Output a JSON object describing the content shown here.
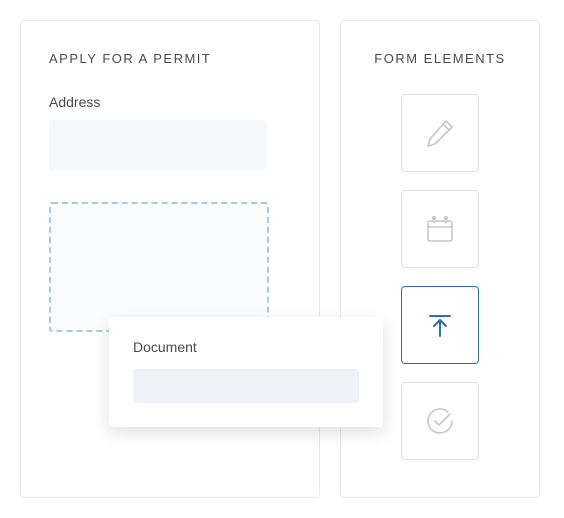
{
  "form": {
    "title": "APPLY FOR A PERMIT",
    "address_label": "Address"
  },
  "floating": {
    "label": "Document"
  },
  "palette": {
    "title": "FORM ELEMENTS",
    "items": [
      {
        "icon": "pencil",
        "active": false
      },
      {
        "icon": "calendar",
        "active": false
      },
      {
        "icon": "upload",
        "active": true
      },
      {
        "icon": "check-circle",
        "active": false
      }
    ]
  },
  "colors": {
    "accent": "#2f6fb0",
    "muted": "#c7c7c7",
    "dropzone_border": "#a9c7e8"
  }
}
